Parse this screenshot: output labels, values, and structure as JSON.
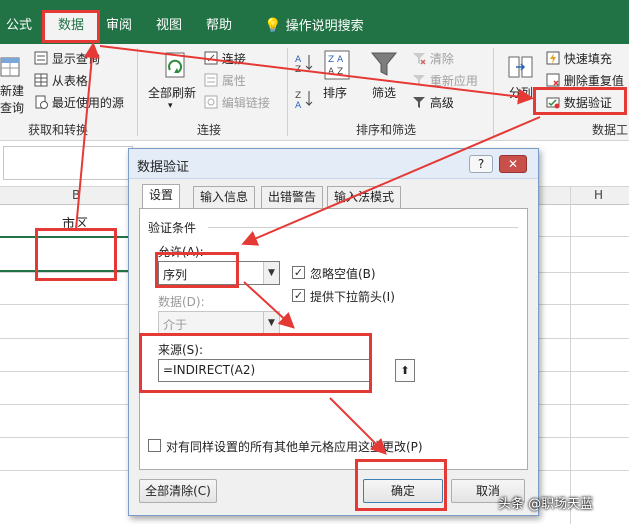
{
  "ribbon": {
    "tabs": [
      "公式",
      "数据",
      "审阅",
      "视图",
      "帮助"
    ],
    "active_tab": "数据",
    "search_label": "操作说明搜索",
    "get_transform": {
      "new_query_label": "新建",
      "new_query_sub": "查询",
      "show_queries": "显示查询",
      "from_table": "从表格",
      "recent_sources": "最近使用的源",
      "group_label": "获取和转换"
    },
    "connections": {
      "refresh_all": "全部刷新",
      "connections": "连接",
      "properties": "属性",
      "edit_links": "编辑链接",
      "group_label": "连接"
    },
    "sort_filter": {
      "sort": "排序",
      "filter": "筛选",
      "clear": "清除",
      "reapply": "重新应用",
      "advanced": "高级",
      "group_label": "排序和筛选"
    },
    "data_tools": {
      "text_to_columns": "分列",
      "flash_fill": "快速填充",
      "remove_duplicates": "删除重复值",
      "data_validation": "数据验证",
      "group_label": "数据工"
    }
  },
  "sheet": {
    "columns": [
      "B",
      "H"
    ],
    "cell_b1": "市区"
  },
  "dialog": {
    "title": "数据验证",
    "help": "?",
    "close": "✕",
    "tabs": [
      "设置",
      "输入信息",
      "出错警告",
      "输入法模式"
    ],
    "active_tab": "设置",
    "section_title": "验证条件",
    "allow_label": "允许(A):",
    "allow_value": "序列",
    "ignore_blank": "忽略空值(B)",
    "dropdown_arrow": "提供下拉箭头(I)",
    "data_label": "数据(D):",
    "data_value": "介于",
    "source_label": "来源(S):",
    "source_value": "=INDIRECT(A2)",
    "apply_all": "对有同样设置的所有其他单元格应用这些更改(P)",
    "clear_all": "全部清除(C)",
    "ok": "确定",
    "cancel": "取消"
  },
  "watermark": "头条 @职场天蓝",
  "colors": {
    "excel_green": "#217346",
    "annotation_red": "#e53935"
  }
}
